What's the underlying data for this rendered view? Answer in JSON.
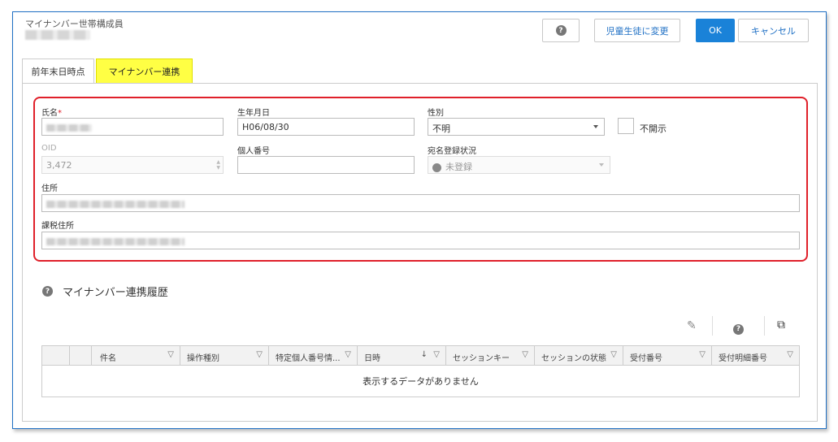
{
  "window": {
    "title": "マイナンバー世帯構成員"
  },
  "header": {
    "help_label": "?",
    "change_student_label": "児童生徒に変更",
    "ok_label": "OK",
    "cancel_label": "キャンセル"
  },
  "tabs": [
    {
      "label": "前年末日時点"
    },
    {
      "label": "マイナンバー連携"
    }
  ],
  "form": {
    "name_label": "氏名",
    "name_required": "*",
    "dob_label": "生年月日",
    "dob_value": "H06/08/30",
    "gender_label": "性別",
    "gender_value": "不明",
    "undisclosed_label": "不開示",
    "oid_label": "OID",
    "oid_value": "3,472",
    "personal_number_label": "個人番号",
    "personal_number_value": "",
    "registration_status_label": "宛名登録状況",
    "registration_status_value": "未登録",
    "address_label": "住所",
    "tax_address_label": "課税住所"
  },
  "history": {
    "title": "マイナンバー連携履歴",
    "columns": [
      "",
      "",
      "件名",
      "操作種別",
      "特定個人番号情...",
      "日時",
      "セッションキー",
      "セッションの状態",
      "受付番号",
      "受付明細番号"
    ],
    "empty_message": "表示するデータがありません"
  },
  "colors": {
    "accent": "#1a82d8",
    "highlight": "#ffff44",
    "annotation": "#e0202a"
  }
}
